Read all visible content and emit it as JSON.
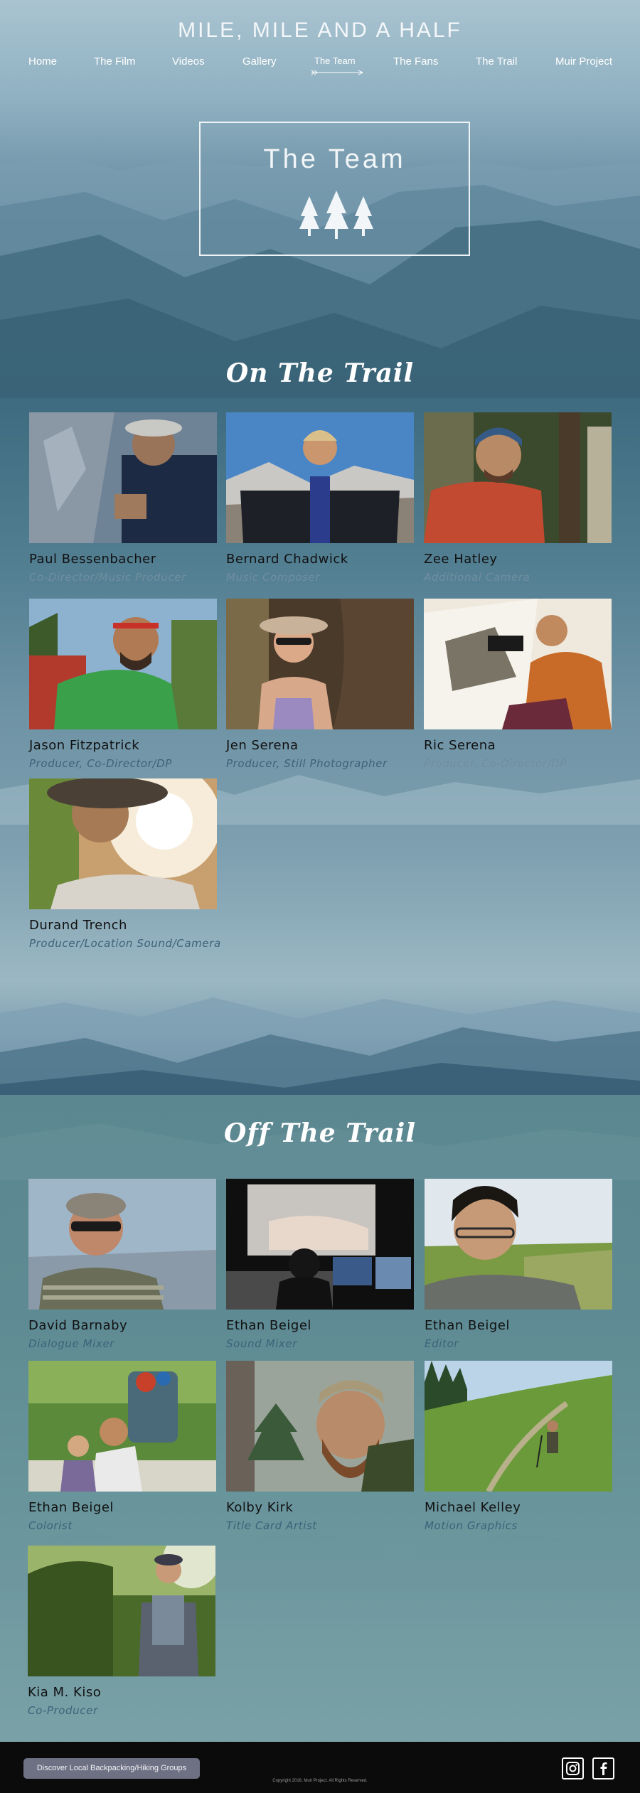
{
  "site": {
    "title": "MILE, MILE AND A HALF"
  },
  "nav": {
    "items": [
      {
        "label": "Home"
      },
      {
        "label": "The Film"
      },
      {
        "label": "Videos"
      },
      {
        "label": "Gallery"
      },
      {
        "label": "The Team",
        "active": true
      },
      {
        "label": "The Fans"
      },
      {
        "label": "The Trail"
      },
      {
        "label": "Muir Project"
      }
    ]
  },
  "banner": {
    "title": "The Team",
    "icon": "three-pine-trees-icon"
  },
  "on_trail": {
    "title": "On The Trail",
    "members": [
      {
        "name": "Paul Bessenbacher",
        "role": "Co-Director/Music Producer"
      },
      {
        "name": "Bernard Chadwick",
        "role": "Music Composer"
      },
      {
        "name": "Zee Hatley",
        "role": "Additional Camera"
      },
      {
        "name": "Jason Fitzpatrick",
        "role": "Producer, Co-Director/DP"
      },
      {
        "name": "Jen Serena",
        "role": "Producer, Still Photographer"
      },
      {
        "name": "Ric Serena",
        "role": "Producer, Co-Director/DP"
      },
      {
        "name": "Durand Trench",
        "role": "Producer/Location Sound/Camera"
      }
    ]
  },
  "off_trail": {
    "title": "Off The Trail",
    "members": [
      {
        "name": "David Barnaby",
        "role": "Dialogue Mixer"
      },
      {
        "name": "Ethan Beigel",
        "role": "Sound Mixer"
      },
      {
        "name": "Ethan Beigel",
        "role": "Editor"
      },
      {
        "name": "Ethan Beigel",
        "role": "Colorist"
      },
      {
        "name": "Kolby Kirk",
        "role": "Title Card Artist"
      },
      {
        "name": "Michael Kelley",
        "role": "Motion Graphics"
      },
      {
        "name": "Kia M. Kiso",
        "role": "Co-Producer"
      }
    ]
  },
  "footer": {
    "button_label": "Discover Local Backpacking/Hiking Groups",
    "copyright": "Copyright 2016, Muir Project. All Rights Reserved.",
    "social": [
      {
        "icon": "instagram-icon"
      },
      {
        "icon": "facebook-icon"
      }
    ]
  },
  "colors": {
    "role_text": "#3d627a",
    "footer_bg": "#0b0b0b",
    "button_bg": "#6e7184"
  }
}
